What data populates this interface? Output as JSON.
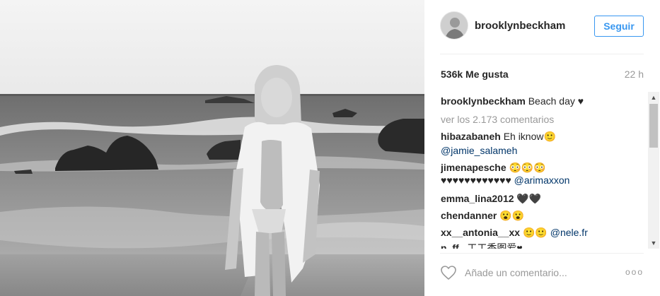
{
  "photo": {
    "alt_subject": "woman-on-beach-photo"
  },
  "header": {
    "username": "brooklynbeckham",
    "follow_label": "Seguir"
  },
  "stats": {
    "likes": "536k Me gusta",
    "time_ago": "22 h"
  },
  "caption": {
    "username": "brooklynbeckham",
    "text": "Beach day ♥"
  },
  "view_all": "ver los 2.173 comentarios",
  "comments": [
    {
      "user": "hibazabaneh",
      "text": "Eh iknow🙂",
      "mention": "@jamie_salameh"
    },
    {
      "user": "jimenapesche",
      "text": "😳😳😳",
      "hearts": "♥♥♥♥♥♥♥♥♥♥♥♥",
      "mention": "@arimaxxon"
    },
    {
      "user": "emma_lina2012",
      "text": "🖤🖤"
    },
    {
      "user": "chendanner",
      "text": "😮😮"
    },
    {
      "user": "xx__antonia__xx",
      "text": "🙂🙂",
      "mention": "@nele.fr"
    },
    {
      "user": "n_ff_",
      "text": "工工香图爱♥"
    }
  ],
  "footer": {
    "comment_placeholder": "Añade un comentario...",
    "more_options": "ooo"
  },
  "colors": {
    "accent": "#3897f0",
    "mention": "#003569",
    "muted": "#999999"
  }
}
